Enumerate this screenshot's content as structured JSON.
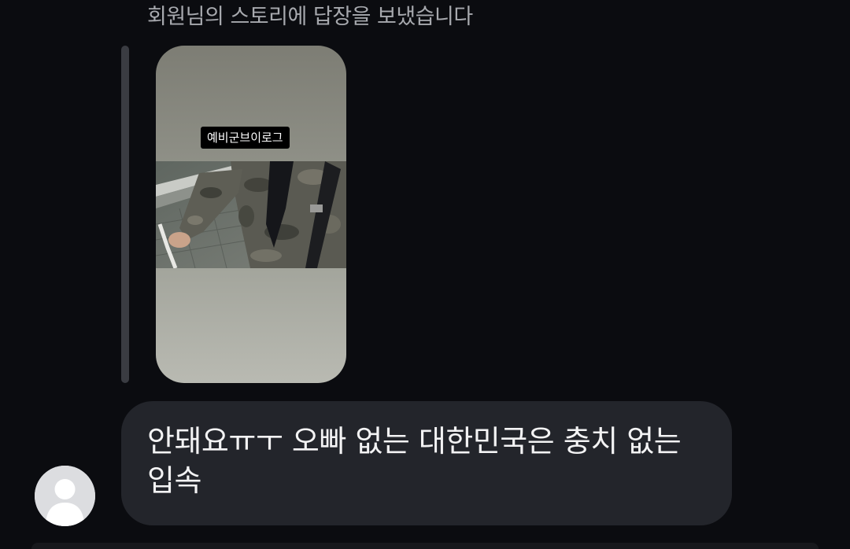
{
  "reply_notice": "회원님의 스토리에 답장을 보냈습니다",
  "story": {
    "caption": "예비군브이로그",
    "photo_description_icon": "story-photo"
  },
  "message": {
    "text": "안돼요ㅠㅜ 오빠 없는 대한민국은 충치 없는 입속"
  },
  "avatar": {
    "icon": "default-user-avatar-icon"
  },
  "colors": {
    "background": "#0b0c10",
    "bubble": "#23252b",
    "notice_text": "#a7a9ae",
    "message_text": "#f3f3f4",
    "quote_bar": "#3a3c42"
  }
}
